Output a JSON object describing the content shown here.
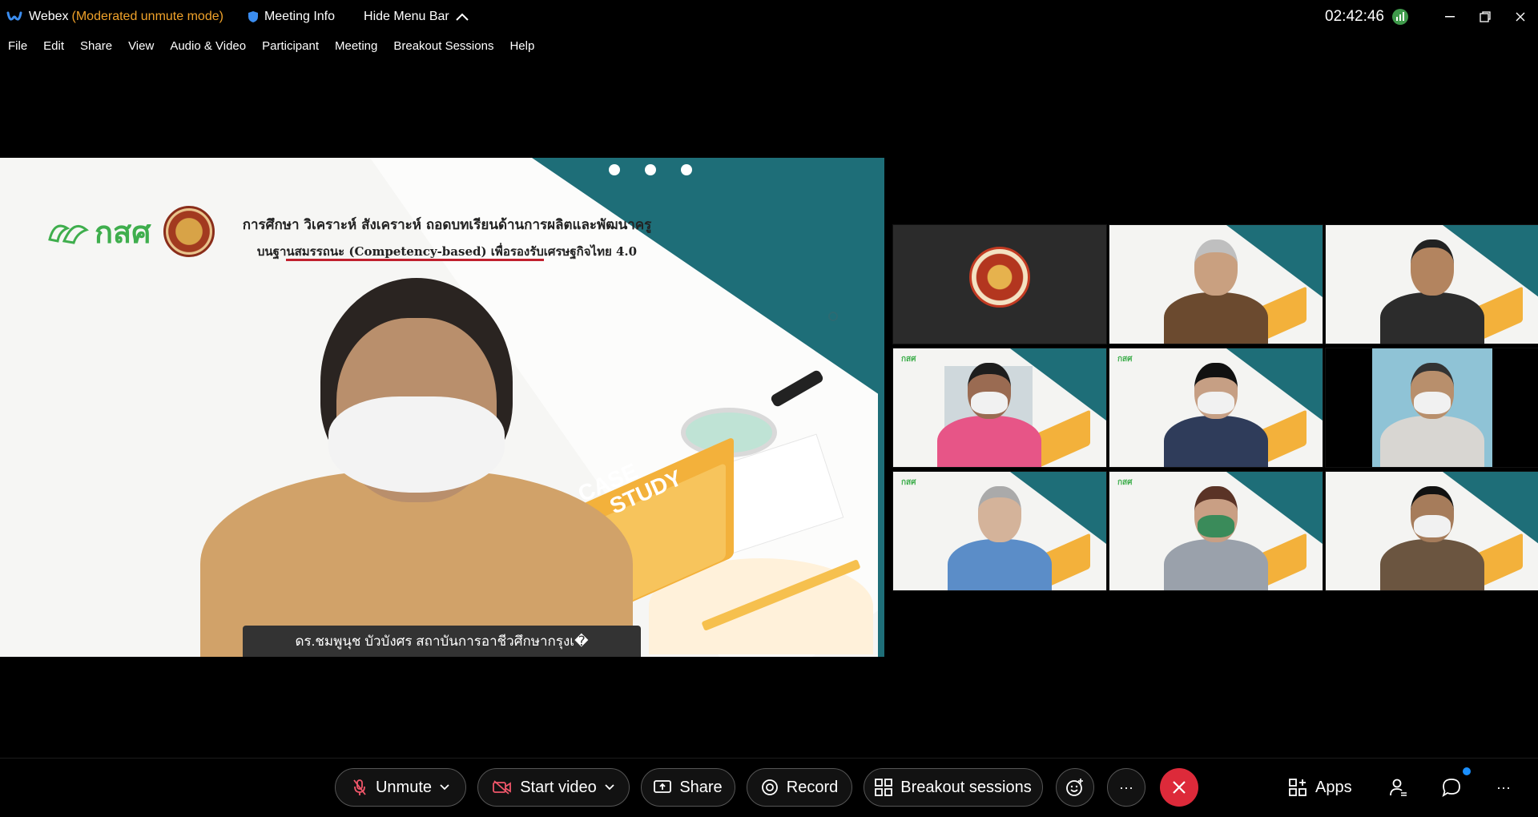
{
  "titlebar": {
    "app_name": "Webex",
    "mode": "(Moderated unmute mode)",
    "meeting_info": "Meeting Info",
    "hide_menu": "Hide Menu Bar",
    "clock": "02:42:46"
  },
  "menu": [
    "File",
    "Edit",
    "Share",
    "View",
    "Audio & Video",
    "Participant",
    "Meeting",
    "Breakout Sessions",
    "Help"
  ],
  "slide": {
    "logo_text": "กสศ",
    "title_line1": "การศึกษา วิเคราะห์ สังเคราะห์ ถอดบทเรียนด้านการผลิตและพัฒนาครู",
    "title_line2": "บนฐานสมรรถนะ (Competency-based) เพื่อรองรับเศรษฐกิจไทย 4.0",
    "case_line1": "CASE",
    "case_line2": "STUDY"
  },
  "speaker_name": "ดร.ชมพูนุช บัวบังศร สถาบันการอาชีวศึกษากรุงเ�",
  "toolbar": {
    "unmute": "Unmute",
    "start_video": "Start video",
    "share": "Share",
    "record": "Record",
    "breakout": "Breakout sessions",
    "more": "···",
    "apps": "Apps",
    "overflow": "···"
  },
  "colors": {
    "mode_orange": "#f0a22a",
    "end_red": "#dd2a3a",
    "teal": "#1e6e78",
    "brand_green": "#3fae4d"
  }
}
